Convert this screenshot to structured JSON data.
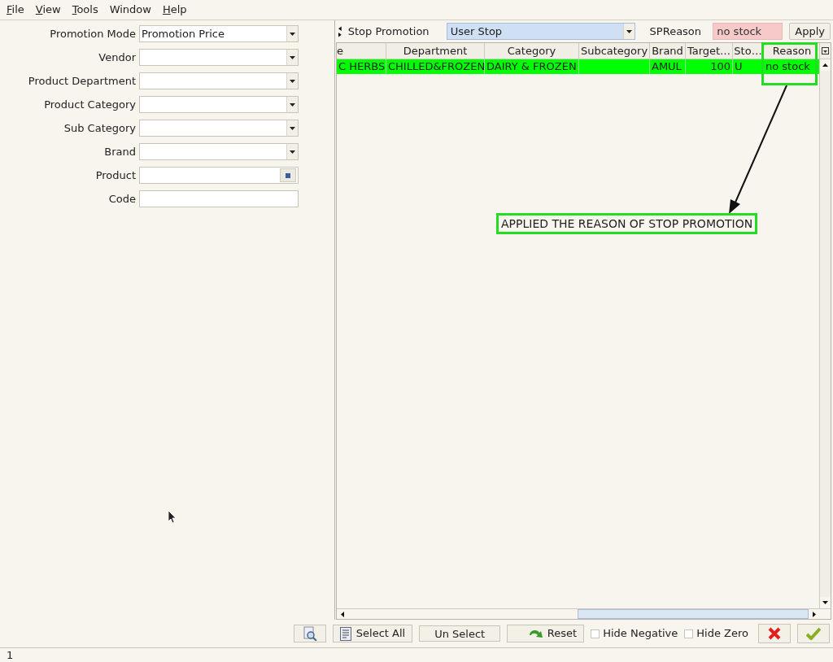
{
  "menu": [
    {
      "label": "File",
      "underlined": true
    },
    {
      "label": "View",
      "underlined": true
    },
    {
      "label": "Tools",
      "underlined": true
    },
    {
      "label": "Window",
      "underlined": false
    },
    {
      "label": "Help",
      "underlined": true
    }
  ],
  "filters": [
    {
      "label": "Promotion Mode",
      "kind": "dropdown",
      "value": "Promotion Price"
    },
    {
      "label": "Vendor",
      "kind": "dropdown"
    },
    {
      "label": "Product Department",
      "kind": "dropdown"
    },
    {
      "label": "Product Category",
      "kind": "dropdown"
    },
    {
      "label": "Sub Category",
      "kind": "dropdown"
    },
    {
      "label": "Brand",
      "kind": "dropdown"
    },
    {
      "label": "Product",
      "kind": "lookup"
    },
    {
      "label": "Code",
      "kind": "text"
    }
  ],
  "stop_bar": {
    "label": "Stop Promotion",
    "mode": "User Stop",
    "reason_label": "SPReason",
    "reason": "no stock",
    "apply": "Apply"
  },
  "table": {
    "columns": [
      "e",
      "Department",
      "Category",
      "Subcategory",
      "Brand",
      "Target…",
      "Sto…",
      "Reason"
    ],
    "rows": [
      {
        "selected": true,
        "cells": [
          "C HERBS",
          "CHILLED&FROZEN",
          "DAIRY & FROZEN",
          "",
          "AMUL",
          "100",
          "U",
          "no stock"
        ]
      }
    ]
  },
  "annotation": {
    "text": "APPLIED THE REASON OF STOP PROMOTION"
  },
  "toolbar": {
    "select_all": "Select All",
    "unselect": "Un Select",
    "reset": "Reset",
    "checks": [
      {
        "label": "Hide Negative",
        "checked": false
      },
      {
        "label": "Hide Zero",
        "checked": false
      }
    ]
  },
  "status_bar": "1"
}
